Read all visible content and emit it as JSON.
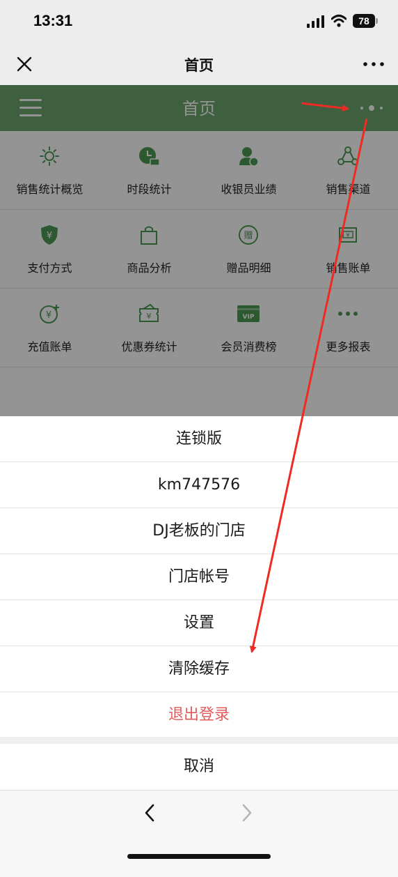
{
  "status_bar": {
    "time": "13:31",
    "battery": "78",
    "icons": [
      "signal-icon",
      "wifi-icon",
      "battery-icon"
    ]
  },
  "title_bar": {
    "title": "首页",
    "close_icon": "close-icon",
    "more_icon": "more-icon"
  },
  "app_header": {
    "title": "首页",
    "color": "#6ba56b",
    "menu_icon": "hamburger-icon",
    "dots_icon": "dots-icon"
  },
  "grid": [
    [
      {
        "label": "销售统计概览",
        "icon": "sun-icon"
      },
      {
        "label": "时段统计",
        "icon": "clock-icon"
      },
      {
        "label": "收银员业绩",
        "icon": "cashier-icon"
      },
      {
        "label": "销售渠道",
        "icon": "channel-icon"
      }
    ],
    [
      {
        "label": "支付方式",
        "icon": "payment-shield-icon"
      },
      {
        "label": "商品分析",
        "icon": "shopping-bag-icon"
      },
      {
        "label": "赠品明细",
        "icon": "gift-icon"
      },
      {
        "label": "销售账单",
        "icon": "receipt-icon"
      }
    ],
    [
      {
        "label": "充值账单",
        "icon": "recharge-icon"
      },
      {
        "label": "优惠券统计",
        "icon": "coupon-icon"
      },
      {
        "label": "会员消费榜",
        "icon": "vip-card-icon"
      },
      {
        "label": "更多报表",
        "icon": "more-dots-icon"
      }
    ]
  ],
  "action_sheet": {
    "items": [
      "连锁版",
      "km747576",
      "DJ老板的门店",
      "门店帐号",
      "设置",
      "清除缓存",
      "退出登录"
    ],
    "cancel": "取消",
    "danger_color": "#e25b5b"
  },
  "browser_bar": {
    "back_icon": "chevron-left-icon",
    "forward_icon": "chevron-right-icon"
  },
  "annotation_color": "#ee2a24"
}
